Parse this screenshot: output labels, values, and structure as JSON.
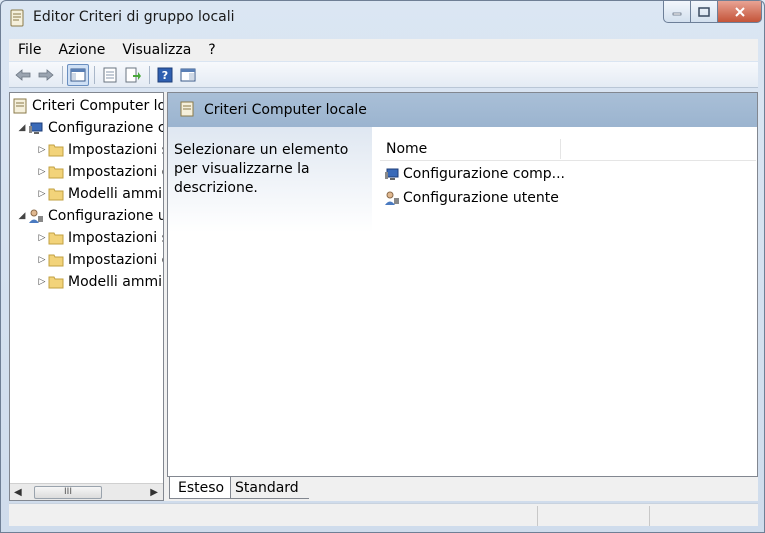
{
  "window": {
    "title": "Editor Criteri di gruppo locali"
  },
  "menu": [
    "File",
    "Azione",
    "Visualizza",
    "?"
  ],
  "toolbar": {
    "buttons": [
      "back-arrow-icon",
      "forward-arrow-icon",
      "show-hide-tree-icon",
      "properties-icon",
      "export-list-icon",
      "help-icon",
      "extended-view-icon"
    ]
  },
  "tree": {
    "root": "Criteri Computer locale",
    "nodes": [
      {
        "label": "Configurazione computer",
        "children": [
          "Impostazioni software",
          "Impostazioni di Windows",
          "Modelli amministrativi"
        ]
      },
      {
        "label": "Configurazione utente",
        "children": [
          "Impostazioni software",
          "Impostazioni di Windows",
          "Modelli amministrativi"
        ]
      }
    ]
  },
  "scrollbar": {
    "thumb_label": "III"
  },
  "right_pane": {
    "header_title": "Criteri Computer locale",
    "description": "Selezionare un elemento per visualizzarne la descrizione.",
    "column_header": "Nome",
    "items": [
      "Configurazione comp...",
      "Configurazione utente"
    ]
  },
  "tabs": [
    "Esteso",
    "Standard"
  ],
  "colors": {
    "header_blue": "#9bb4cf",
    "folder_yellow": "#f2d37a",
    "close_red": "#c45439"
  }
}
